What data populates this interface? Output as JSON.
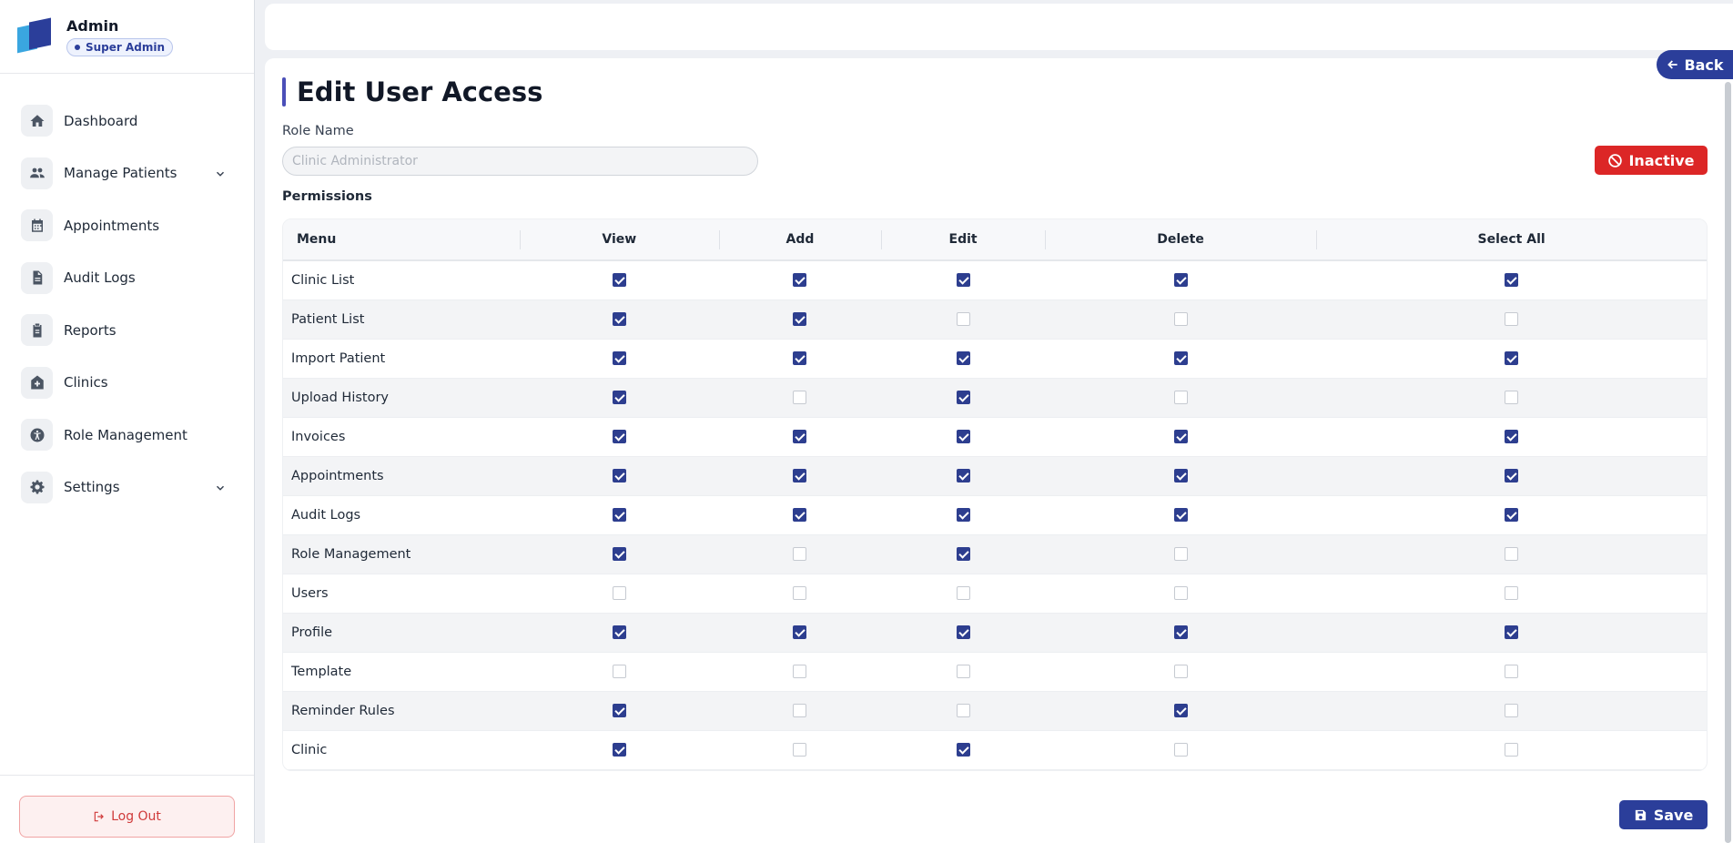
{
  "sidebar": {
    "user_name": "Admin",
    "role_badge": "Super Admin",
    "items": [
      {
        "label": "Dashboard",
        "icon": "home-icon",
        "has_children": false
      },
      {
        "label": "Manage Patients",
        "icon": "users-icon",
        "has_children": true
      },
      {
        "label": "Appointments",
        "icon": "calendar-icon",
        "has_children": false
      },
      {
        "label": "Audit Logs",
        "icon": "file-icon",
        "has_children": false
      },
      {
        "label": "Reports",
        "icon": "clipboard-icon",
        "has_children": false
      },
      {
        "label": "Clinics",
        "icon": "clinic-icon",
        "has_children": false
      },
      {
        "label": "Role Management",
        "icon": "accessibility-icon",
        "has_children": false
      },
      {
        "label": "Settings",
        "icon": "gear-icon",
        "has_children": true
      }
    ],
    "logout_label": "Log Out"
  },
  "header": {
    "back_label": "Back",
    "page_title": "Edit User Access"
  },
  "form": {
    "role_name_label": "Role Name",
    "role_name_placeholder": "Clinic Administrator",
    "role_name_value": "",
    "status_label": "Inactive",
    "permissions_label": "Permissions"
  },
  "permissions": {
    "columns": [
      "Menu",
      "View",
      "Add",
      "Edit",
      "Delete",
      "Select All"
    ],
    "rows": [
      {
        "menu": "Clinic List",
        "view": true,
        "add": true,
        "edit": true,
        "delete": true,
        "all": true
      },
      {
        "menu": "Patient List",
        "view": true,
        "add": true,
        "edit": false,
        "delete": false,
        "all": false
      },
      {
        "menu": "Import Patient",
        "view": true,
        "add": true,
        "edit": true,
        "delete": true,
        "all": true
      },
      {
        "menu": "Upload History",
        "view": true,
        "add": false,
        "edit": true,
        "delete": false,
        "all": false
      },
      {
        "menu": "Invoices",
        "view": true,
        "add": true,
        "edit": true,
        "delete": true,
        "all": true
      },
      {
        "menu": "Appointments",
        "view": true,
        "add": true,
        "edit": true,
        "delete": true,
        "all": true
      },
      {
        "menu": "Audit Logs",
        "view": true,
        "add": true,
        "edit": true,
        "delete": true,
        "all": true
      },
      {
        "menu": "Role Management",
        "view": true,
        "add": false,
        "edit": true,
        "delete": false,
        "all": false
      },
      {
        "menu": "Users",
        "view": false,
        "add": false,
        "edit": false,
        "delete": false,
        "all": false
      },
      {
        "menu": "Profile",
        "view": true,
        "add": true,
        "edit": true,
        "delete": true,
        "all": true
      },
      {
        "menu": "Template",
        "view": false,
        "add": false,
        "edit": false,
        "delete": false,
        "all": false
      },
      {
        "menu": "Reminder Rules",
        "view": true,
        "add": false,
        "edit": false,
        "delete": true,
        "all": false
      },
      {
        "menu": "Clinic",
        "view": true,
        "add": false,
        "edit": true,
        "delete": false,
        "all": false
      }
    ]
  },
  "actions": {
    "save_label": "Save"
  },
  "colors": {
    "primary": "#2b3e9a",
    "danger": "#dc2626",
    "accent_bar": "#4b4fb8"
  }
}
